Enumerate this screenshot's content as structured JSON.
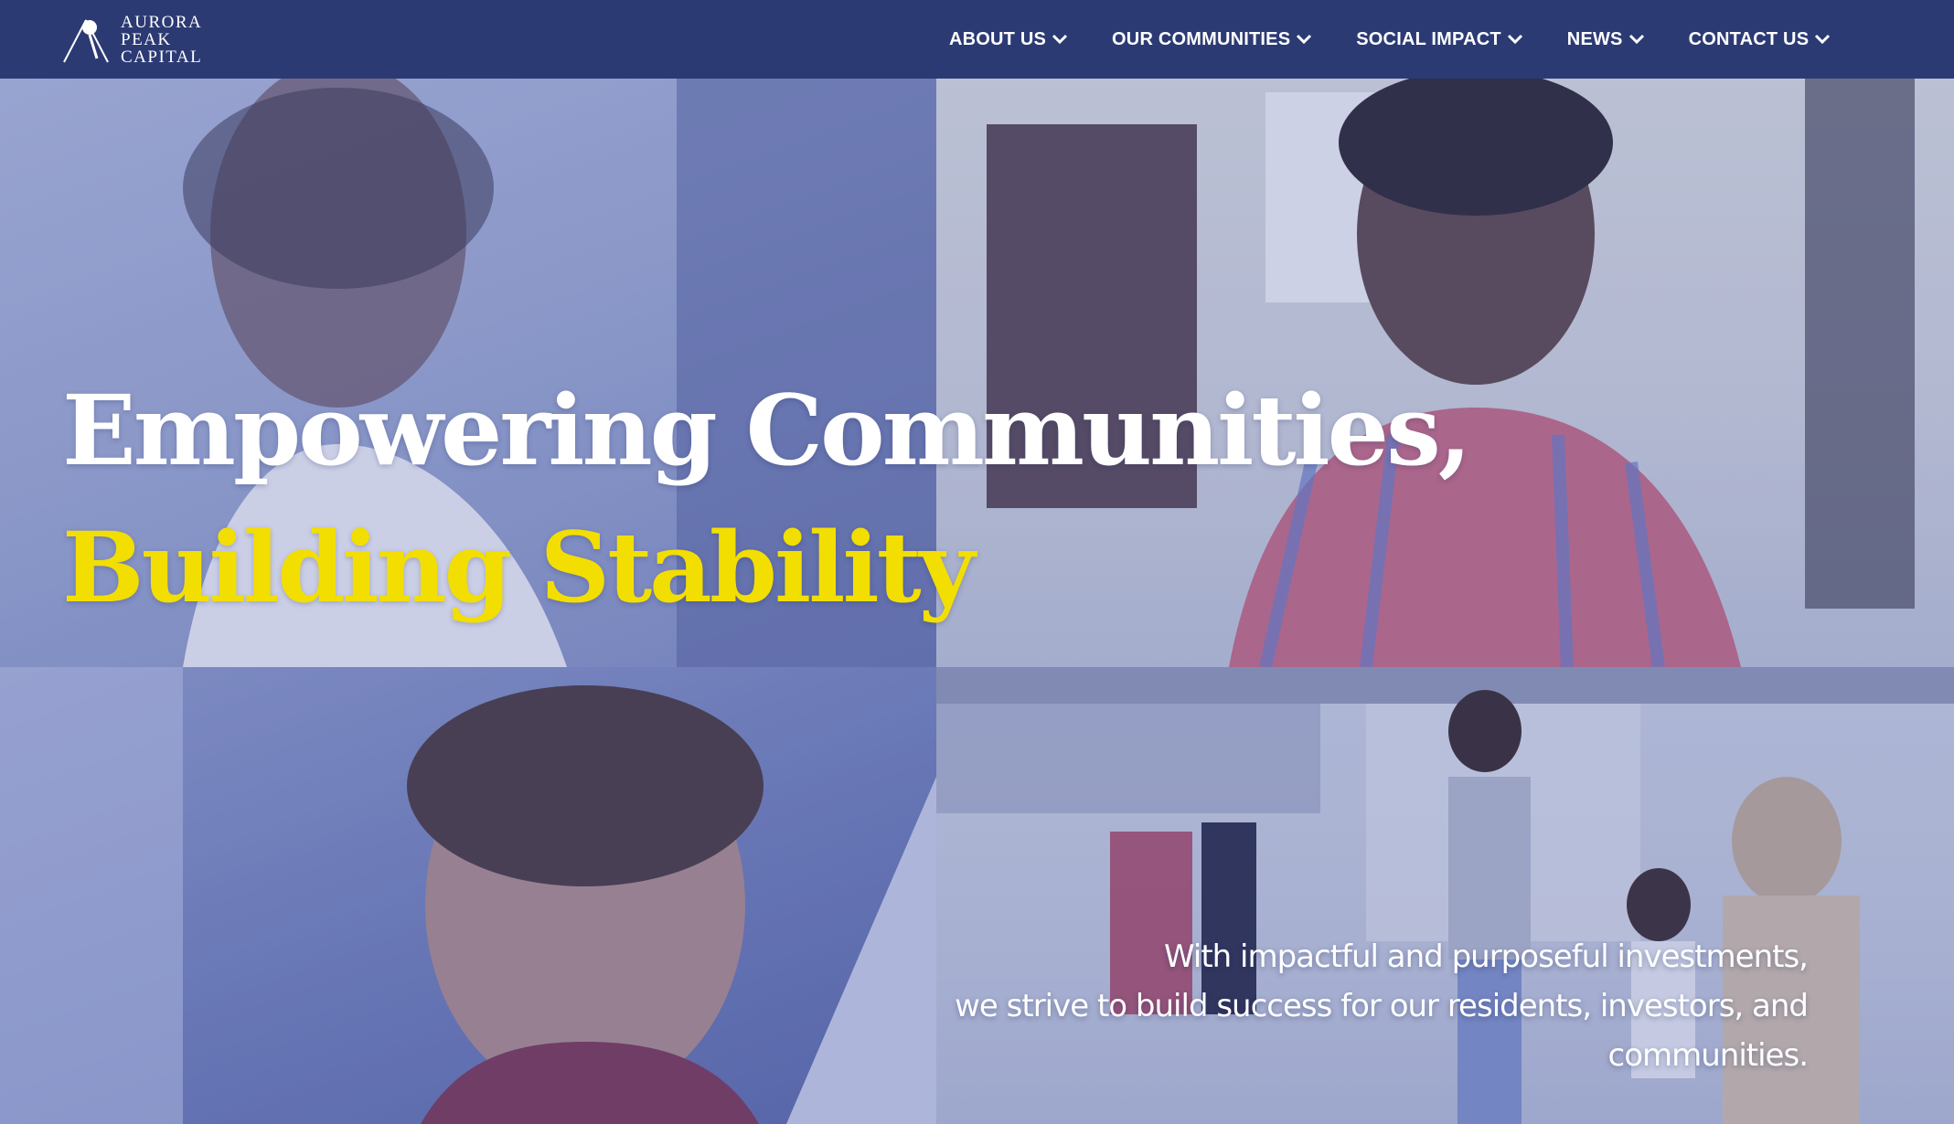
{
  "brand": {
    "name_lines": [
      "AURORA",
      "PEAK",
      "CAPITAL"
    ],
    "logo_icon": "mountain-peak-logo-icon"
  },
  "nav": {
    "items": [
      {
        "label": "ABOUT US",
        "icon": "chevron-down-icon"
      },
      {
        "label": "OUR COMMUNITIES",
        "icon": "chevron-down-icon"
      },
      {
        "label": "SOCIAL IMPACT",
        "icon": "chevron-down-icon"
      },
      {
        "label": "NEWS",
        "icon": "chevron-down-icon"
      },
      {
        "label": "CONTACT US",
        "icon": "chevron-down-icon"
      }
    ]
  },
  "hero": {
    "headline_line1": "Empowering Communities,",
    "headline_line2": "Building Stability",
    "subtext_lines": [
      "With impactful and purposeful investments,",
      "we strive to build success for our residents, investors, and",
      "communities."
    ]
  },
  "colors": {
    "header_bg": "#2c3a74",
    "headline_white": "#ffffff",
    "headline_accent": "#f2de00"
  }
}
